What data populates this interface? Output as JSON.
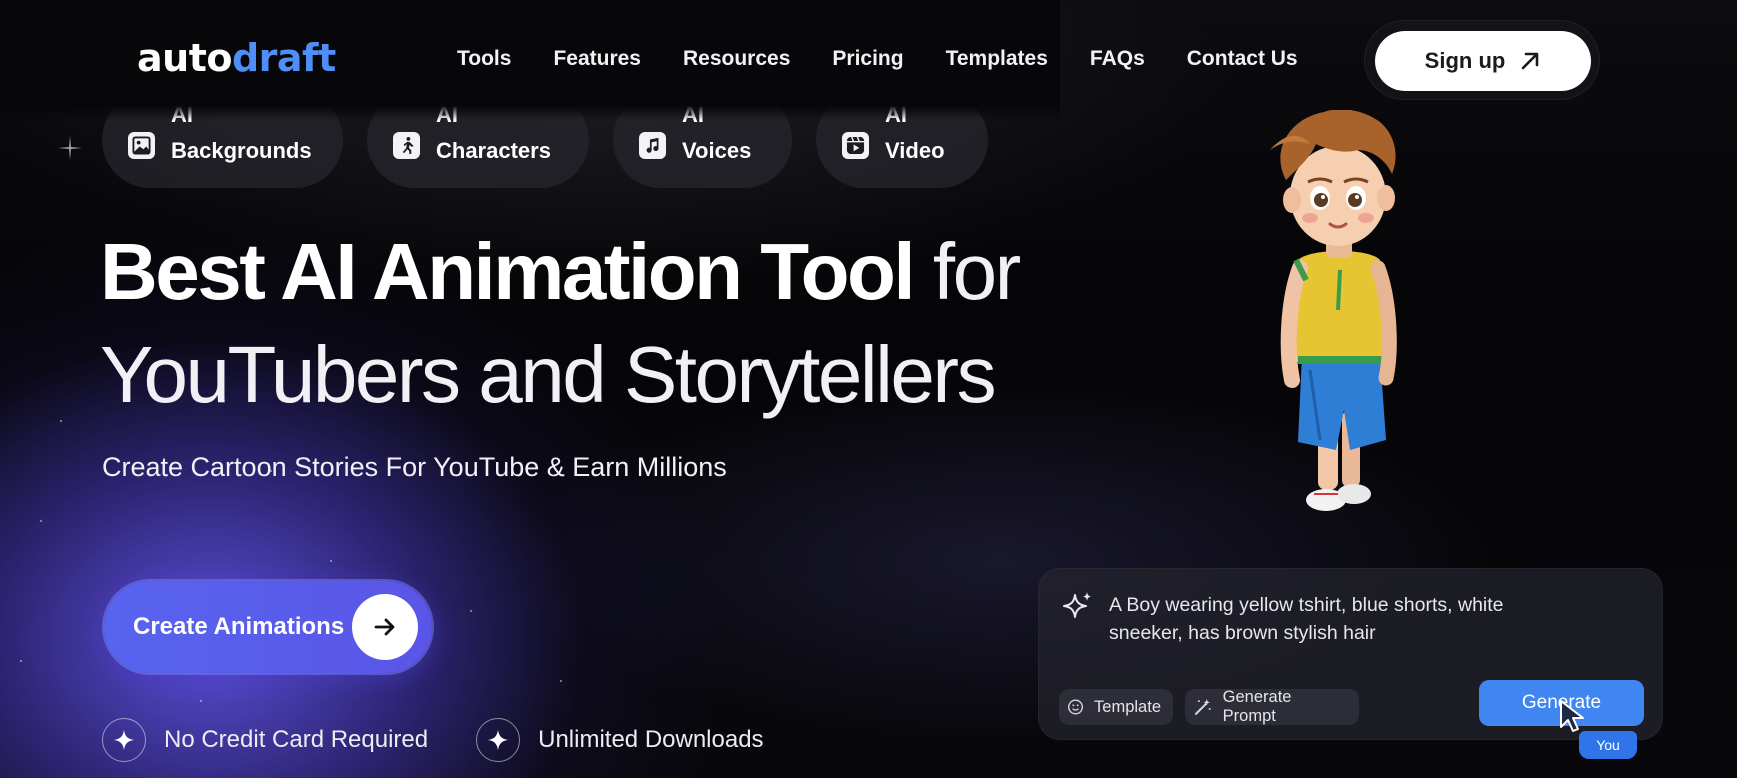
{
  "brand": {
    "logo_part1": "auto",
    "logo_part2": "draft",
    "accent": "#4f8ef7"
  },
  "nav": {
    "links": [
      "Tools",
      "Features",
      "Resources",
      "Pricing",
      "Templates",
      "FAQs",
      "Contact Us"
    ],
    "signup_label": "Sign up",
    "signup_icon": "arrow-up-right-icon"
  },
  "pills": [
    {
      "top": "AI",
      "bottom": "Backgrounds",
      "icon": "image-icon"
    },
    {
      "top": "AI",
      "bottom": "Characters",
      "icon": "running-person-icon"
    },
    {
      "top": "AI",
      "bottom": "Voices",
      "icon": "music-note-icon"
    },
    {
      "top": "AI",
      "bottom": "Video",
      "icon": "video-play-icon"
    }
  ],
  "hero": {
    "title_bold": "Best AI Animation Tool",
    "title_thin": " for",
    "title_line2": "YouTubers and Storytellers",
    "subtitle": "Create Cartoon Stories For YouTube & Earn Millions",
    "cta_label": "Create Animations",
    "cta_icon": "arrow-right-icon",
    "cta_color": "#5a5fec"
  },
  "perks": [
    {
      "label": "No Credit Card Required",
      "icon": "sparkle-icon"
    },
    {
      "label": "Unlimited Downloads",
      "icon": "sparkle-icon"
    }
  ],
  "prompt_card": {
    "prompt": "A Boy wearing yellow tshirt, blue shorts, white sneeker, has brown stylish hair",
    "template_label": "Template",
    "generate_prompt_label": "Generate Prompt",
    "generate_label": "Generate",
    "cursor_tag": "You",
    "button_color": "#3f86f0"
  }
}
